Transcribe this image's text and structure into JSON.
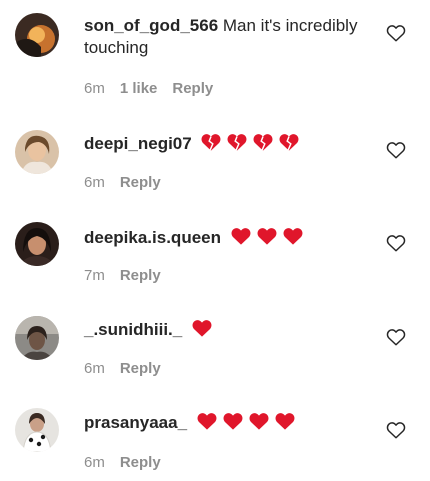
{
  "comments": [
    {
      "username": "son_of_god_566",
      "text": "Man it's incredibly touching",
      "hearts": [],
      "time": "6m",
      "likes": "1 like",
      "reply": "Reply"
    },
    {
      "username": "deepi_negi07",
      "text": "",
      "hearts": [
        "broken-heart-icon",
        "broken-heart-icon",
        "broken-heart-icon",
        "broken-heart-icon"
      ],
      "time": "6m",
      "likes": "",
      "reply": "Reply"
    },
    {
      "username": "deepika.is.queen",
      "text": "",
      "hearts": [
        "red-heart-icon",
        "red-heart-icon",
        "red-heart-icon"
      ],
      "time": "7m",
      "likes": "",
      "reply": "Reply"
    },
    {
      "username": "_.sunidhiii._",
      "text": "",
      "hearts": [
        "red-heart-icon"
      ],
      "time": "6m",
      "likes": "",
      "reply": "Reply"
    },
    {
      "username": "prasanyaaa_",
      "text": "",
      "hearts": [
        "red-heart-icon",
        "red-heart-icon",
        "red-heart-icon",
        "red-heart-icon"
      ],
      "time": "6m",
      "likes": "",
      "reply": "Reply"
    }
  ],
  "colors": {
    "text": "#262626",
    "meta": "#8e8e8e",
    "heart": "#e0162b",
    "background": "#ffffff"
  }
}
